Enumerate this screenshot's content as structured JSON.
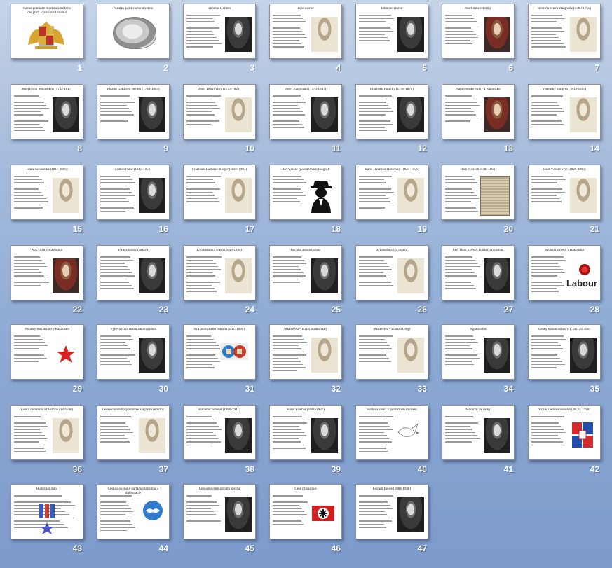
{
  "slides": [
    {
      "number": "1",
      "title": "České politické myšlení a historie\ndle prof. Vratislava Doubka",
      "thumb": "coat"
    },
    {
      "number": "2",
      "title": "Počátky politického myšlení",
      "thumb": "brain"
    },
    {
      "number": "3",
      "title": "Thomas Hobbes",
      "thumb": "portrait"
    },
    {
      "number": "4",
      "title": "John Locke",
      "thumb": "portrait-light"
    },
    {
      "number": "5",
      "title": "Edmund Burke",
      "thumb": "portrait"
    },
    {
      "number": "6",
      "title": "Josefínské reformy",
      "thumb": "portrait-color"
    },
    {
      "number": "7",
      "title": "Bedřich Vilém Haugwitz (1700-1765)",
      "thumb": "portrait-light"
    },
    {
      "number": "8",
      "title": "Joseph von Sonnenfels (1732-1817)",
      "thumb": "portrait"
    },
    {
      "number": "9",
      "title": "Johann Gottfried Herder (1744-1803)",
      "thumb": "portrait"
    },
    {
      "number": "10",
      "title": "Josef Dobrovský (1753-1829)",
      "thumb": "portrait-light"
    },
    {
      "number": "11",
      "title": "Josef Jungmann (1773-1847)",
      "thumb": "portrait"
    },
    {
      "number": "12",
      "title": "František Palacký (1798-1876)",
      "thumb": "portrait"
    },
    {
      "number": "13",
      "title": "Napoleonské války a Rakousko",
      "thumb": "portrait-color"
    },
    {
      "number": "14",
      "title": "Vídeňský kongres (1814-1815)",
      "thumb": "portrait-light"
    },
    {
      "number": "15",
      "title": "Franz Schuselka (1811-1886)",
      "thumb": "portrait-light"
    },
    {
      "number": "16",
      "title": "Ľudovít Štúr (1815-1856)",
      "thumb": "portrait"
    },
    {
      "number": "17",
      "title": "František Ladislav Rieger (1818-1903)",
      "thumb": "portrait-light"
    },
    {
      "number": "18",
      "title": "Jan Václav (pokračování Riegra)",
      "thumb": "silhouette"
    },
    {
      "number": "19",
      "title": "Karel Havlíček Borovský (1821-1856)",
      "thumb": "portrait-light"
    },
    {
      "number": "20",
      "title": "Tisk v letech 1848-1863",
      "thumb": "newspaper"
    },
    {
      "number": "21",
      "title": "Josef Václav Frič (1829-1890)",
      "thumb": "portrait-light"
    },
    {
      "number": "22",
      "title": "Rok 1848 v Rakousku",
      "thumb": "portrait-color"
    },
    {
      "number": "23",
      "title": "Pillersdorfova ústava",
      "thumb": "portrait"
    },
    {
      "number": "24",
      "title": "Kroměřížský sněm (1848-1849)",
      "thumb": "portrait-light"
    },
    {
      "number": "25",
      "title": "Bachův absolutismus",
      "thumb": "portrait"
    },
    {
      "number": "26",
      "title": "Schmerlingova ústava",
      "thumb": "portrait-light"
    },
    {
      "number": "27",
      "title": "Leo Thun a český konzervativismus",
      "thumb": "portrait"
    },
    {
      "number": "28",
      "title": "Sociální změny v Rakousku",
      "thumb": "labour",
      "logo_text": "Labour"
    },
    {
      "number": "29",
      "title": "Počátky socialismu v Rakousku",
      "thumb": "star"
    },
    {
      "number": "30",
      "title": "Vyrovnávací snaha a kompromis",
      "thumb": "portrait"
    },
    {
      "number": "31",
      "title": "Éra politického neklidu (od r. 1880)",
      "thumb": "fists"
    },
    {
      "number": "32",
      "title": "Mladočeši – Karel Sladkovský",
      "thumb": "portrait-light"
    },
    {
      "number": "33",
      "title": "Mladočeši – Eduard Grégr",
      "thumb": "portrait-light"
    },
    {
      "number": "34",
      "title": "Agrarismus",
      "thumb": "portrait"
    },
    {
      "number": "35",
      "title": "Český katolicismus v 1. pol. 20. stol.",
      "thumb": "portrait"
    },
    {
      "number": "36",
      "title": "Česká literatura a filozofie (1870-90)",
      "thumb": "portrait-light"
    },
    {
      "number": "37",
      "title": "České národohospodářské a agrární reformy",
      "thumb": "portrait-light"
    },
    {
      "number": "38",
      "title": "Bohumír Šmeral (1880-1941)",
      "thumb": "portrait"
    },
    {
      "number": "39",
      "title": "Karel Kramář (1860-1937)",
      "thumb": "portrait"
    },
    {
      "number": "40",
      "title": "Světová válka v politickém myšlení",
      "thumb": "dove"
    },
    {
      "number": "41",
      "title": "Masaryk za války",
      "thumb": "portrait"
    },
    {
      "number": "42",
      "title": "Vznik Československa (28.10. 1918)",
      "thumb": "flag"
    },
    {
      "number": "43",
      "title": "Budování státu",
      "thumb": "medals"
    },
    {
      "number": "44",
      "title": "Československý parlamentarismus a diplomacie",
      "thumb": "handshake"
    },
    {
      "number": "45",
      "title": "Československá státní správa",
      "thumb": "portrait"
    },
    {
      "number": "46",
      "title": "Český fašismus",
      "thumb": "swastika-flag"
    },
    {
      "number": "47",
      "title": "Edvard Beneš (1884-1948)",
      "thumb": "portrait"
    }
  ],
  "colors": {
    "star": "#d92020",
    "labour_rose": "#e33333",
    "flag_blue": "#1f4fa8",
    "flag_red": "#d22b2b"
  }
}
